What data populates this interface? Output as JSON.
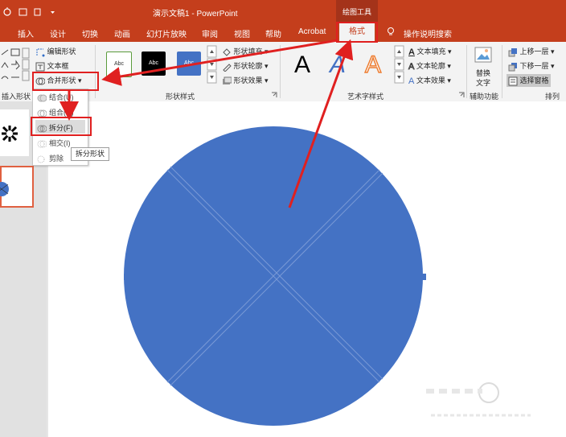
{
  "titlebar": {
    "title": "演示文稿1  -  PowerPoint",
    "context_label": "绘图工具"
  },
  "tabs": [
    "插入",
    "设计",
    "切换",
    "动画",
    "幻灯片放映",
    "审阅",
    "视图",
    "帮助",
    "Acrobat"
  ],
  "active_tab": "格式",
  "tell_me": "操作说明搜索",
  "ribbon": {
    "insert_shapes": {
      "edit_shape": "编辑形状",
      "text_box": "文本框",
      "merge_shapes": "合并形状",
      "group_label": "插入形状"
    },
    "shape_styles": {
      "swatch_labels": [
        "Abc",
        "Abc",
        "Abc"
      ],
      "fill": "形状填充",
      "outline": "形状轮廓",
      "effects": "形状效果",
      "group_label": "形状样式"
    },
    "wordart": {
      "glyph": "A",
      "text_fill": "文本填充",
      "text_outline": "文本轮廓",
      "text_effects": "文本效果",
      "group_label": "艺术字样式"
    },
    "accessibility": {
      "alt_text_line1": "替换",
      "alt_text_line2": "文字",
      "group_label": "辅助功能"
    },
    "arrange": {
      "bring_forward": "上移一层",
      "send_backward": "下移一层",
      "selection_pane": "选择窗格",
      "group_label": "排列"
    }
  },
  "merge_menu": {
    "items": [
      "结合(U)",
      "组合(C)",
      "拆分(F)",
      "相交(I)",
      "剪除"
    ],
    "highlighted": "拆分(F)"
  },
  "tooltip": "拆分形状",
  "colors": {
    "accent": "#c43e1c",
    "shape_fill": "#4472c4",
    "annotation": "#e02020"
  }
}
